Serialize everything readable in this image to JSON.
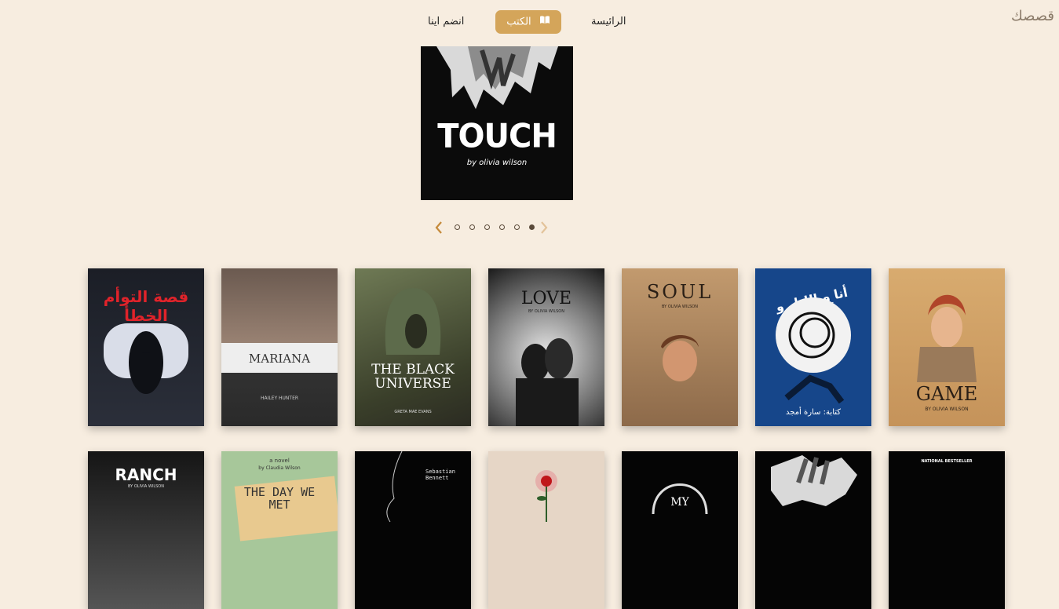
{
  "brand": "قصصك",
  "nav": {
    "join": "انضم اينا",
    "books": "الكتب",
    "home": "الرائيسة"
  },
  "hero": {
    "title": "TOUCH",
    "author": "by olivia wilson"
  },
  "carousel": {
    "total": 6,
    "active_index": 5
  },
  "books_row1": [
    {
      "title": "قصة التوأم الخطأ",
      "subtitle": "",
      "author": ""
    },
    {
      "title": "MARIANA",
      "subtitle": "",
      "author": "HAILEY HUNTER"
    },
    {
      "title": "THE BLACK UNIVERSE",
      "subtitle": "",
      "author": "GRETA MAE EVANS"
    },
    {
      "title": "LOVE",
      "subtitle": "",
      "author": "BY OLIVIA WILSON"
    },
    {
      "title": "SOUL",
      "subtitle": "",
      "author": "BY OLIVIA WILSON"
    },
    {
      "title": "أنا و الليل و أفكاري",
      "subtitle": "",
      "author": "كتابة: سارة أمجد"
    },
    {
      "title": "GAME",
      "subtitle": "",
      "author": "BY OLIVIA WILSON"
    }
  ],
  "books_row2": [
    {
      "title": "RANCH",
      "author": "BY OLIVIA WILSON"
    },
    {
      "title": "THE DAY WE MET",
      "pre": "a novel",
      "author": "by Claudia Wilson"
    },
    {
      "title": "Sebastian Bennett",
      "author": ""
    },
    {
      "title": "",
      "author": ""
    },
    {
      "title": "MY",
      "author": ""
    },
    {
      "title": "",
      "author": ""
    },
    {
      "title": "NATIONAL BESTSELLER",
      "author": ""
    }
  ]
}
